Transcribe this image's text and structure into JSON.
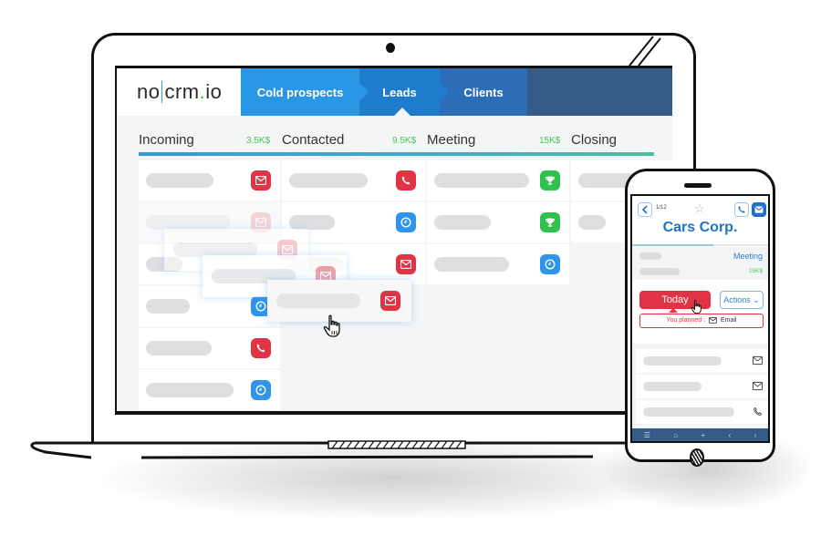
{
  "app": {
    "logo": {
      "part1": "no",
      "part2": "crm",
      "dot": ".",
      "part3": "io"
    },
    "pipeline_tabs": [
      {
        "label": "Cold prospects",
        "active": false
      },
      {
        "label": "Leads",
        "active": true
      },
      {
        "label": "Clients",
        "active": false
      }
    ],
    "columns": [
      {
        "title": "Incoming",
        "amount": "3.5K$"
      },
      {
        "title": "Contacted",
        "amount": "9.5K$"
      },
      {
        "title": "Meeting",
        "amount": "15K$"
      },
      {
        "title": "Closing",
        "amount": ""
      }
    ],
    "cards": {
      "incoming": [
        "email-icon",
        "email-icon",
        "email-icon",
        "clock-icon",
        "phone-icon",
        "clock-icon"
      ],
      "contacted": [
        "phone-icon",
        "clock-icon",
        "email-icon"
      ],
      "meeting": [
        "trophy-icon",
        "trophy-icon",
        "clock-icon"
      ],
      "closing": [
        "",
        ""
      ]
    },
    "dragged_card_icon": "email-icon",
    "colors": {
      "red": "#e03444",
      "blue": "#2f94ec",
      "green": "#2fc04e",
      "amount_green": "#43c65a",
      "brand_blue": "#1f72c8"
    }
  },
  "mobile": {
    "counter": "1/12",
    "title": "Cars Corp.",
    "stage": "Meeting",
    "amount": "15K$",
    "progress_percent": 60,
    "today_label": "Today",
    "actions_label": "Actions",
    "planned_label": "You planned :",
    "planned_value": "Email",
    "list_icons": [
      "email-icon",
      "email-icon",
      "phone-icon"
    ],
    "nav": [
      "menu-icon",
      "home-icon",
      "add-icon",
      "previous-icon",
      "next-icon"
    ]
  }
}
